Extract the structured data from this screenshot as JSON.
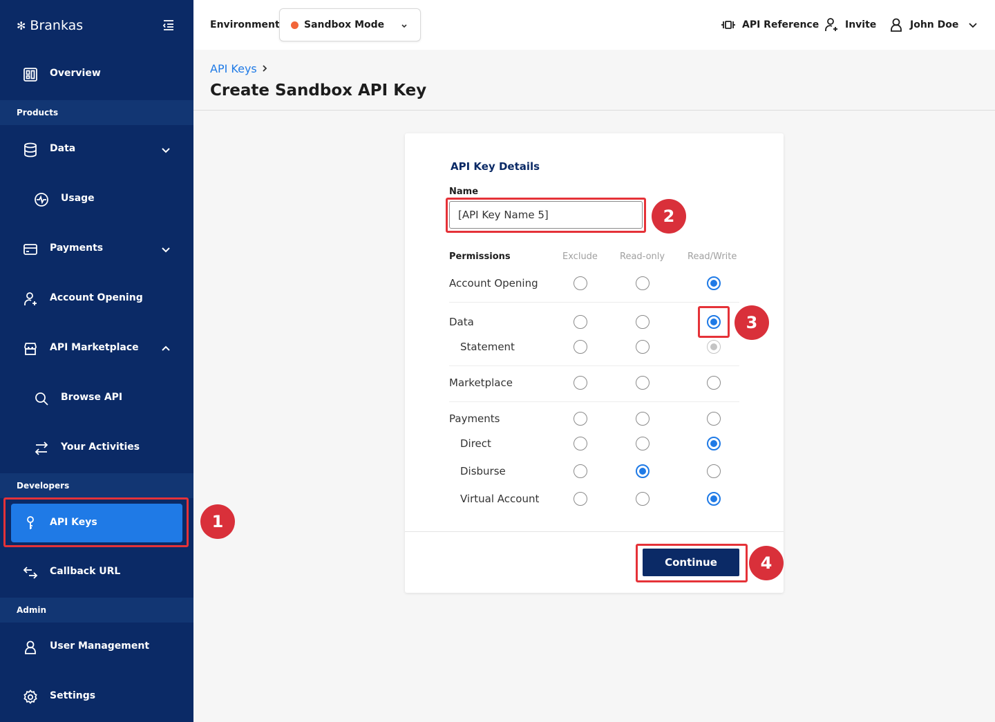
{
  "brand": {
    "name": "Brankas"
  },
  "sidebar": {
    "overview": "Overview",
    "products_section": "Products",
    "data": "Data",
    "usage": "Usage",
    "payments": "Payments",
    "account_opening": "Account Opening",
    "api_marketplace": "API Marketplace",
    "browse_api": "Browse API",
    "your_activities": "Your Activities",
    "developers_section": "Developers",
    "api_keys": "API Keys",
    "callback_url": "Callback URL",
    "admin_section": "Admin",
    "user_management": "User Management",
    "settings": "Settings"
  },
  "header": {
    "environment_label": "Environment:",
    "environment_value": "Sandbox Mode",
    "environment_color": "#f26539",
    "api_reference": "API Reference",
    "invite": "Invite",
    "user_name": "John Doe"
  },
  "page": {
    "breadcrumb": "API Keys",
    "title": "Create Sandbox API Key"
  },
  "form": {
    "section_title": "API Key Details",
    "name_label": "Name",
    "name_value": "[API Key Name 5]",
    "permissions_label": "Permissions",
    "columns": [
      "Exclude",
      "Read-only",
      "Read/Write"
    ],
    "rows": [
      {
        "label": "Account Opening",
        "selected": "Read/Write"
      },
      {
        "label": "Data",
        "selected": "Read/Write"
      },
      {
        "label": "Statement",
        "selected": "Read/Write",
        "disabled": true
      },
      {
        "label": "Marketplace",
        "selected": "none"
      },
      {
        "label": "Payments",
        "selected": "none"
      },
      {
        "label": "Direct",
        "selected": "Read/Write"
      },
      {
        "label": "Disburse",
        "selected": "Read-only"
      },
      {
        "label": "Virtual Account",
        "selected": "Read/Write"
      }
    ],
    "continue_label": "Continue"
  },
  "annotations": {
    "badge_1": "1",
    "badge_2": "2",
    "badge_3": "3",
    "badge_4": "4",
    "highlight_color": "#e53238"
  },
  "colors": {
    "sidebar_bg": "#0b2a66",
    "accent": "#1f7ae6"
  }
}
